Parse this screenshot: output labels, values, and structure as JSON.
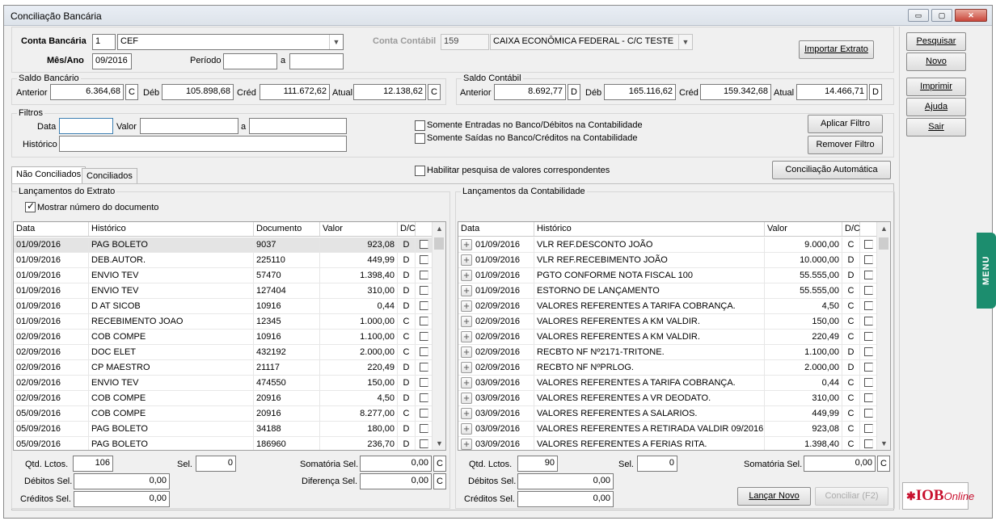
{
  "window": {
    "title": "Conciliação Bancária",
    "min": "▭",
    "restore": "▢",
    "close": "✕"
  },
  "header": {
    "conta_bancaria_label": "Conta Bancária",
    "conta_bancaria_code": "1",
    "conta_bancaria_name": "CEF",
    "mes_ano_label": "Mês/Ano",
    "mes_ano_value": "09/2016",
    "periodo_label": "Período",
    "periodo_from": "",
    "periodo_sep": "a",
    "periodo_to": "",
    "conta_contabil_label": "Conta Contábil",
    "conta_contabil_code": "159",
    "conta_contabil_name": "CAIXA ECONÔMICA FEDERAL - C/C TESTE",
    "importar": "Importar Extrato"
  },
  "saldo_bancario": {
    "title": "Saldo Bancário",
    "anterior_label": "Anterior",
    "anterior": "6.364,68",
    "anterior_dc": "C",
    "deb_label": "Déb",
    "deb": "105.898,68",
    "cred_label": "Créd",
    "cred": "111.672,62",
    "atual_label": "Atual",
    "atual": "12.138,62",
    "atual_dc": "C"
  },
  "saldo_contabil": {
    "title": "Saldo Contábil",
    "anterior_label": "Anterior",
    "anterior": "8.692,77",
    "anterior_dc": "D",
    "deb_label": "Déb",
    "deb": "165.116,62",
    "cred_label": "Créd",
    "cred": "159.342,68",
    "atual_label": "Atual",
    "atual": "14.466,71",
    "atual_dc": "D"
  },
  "filtros": {
    "title": "Filtros",
    "data_label": "Data",
    "valor_label": "Valor",
    "sep": "a",
    "historico_label": "Histórico",
    "chk1": "Somente  Entradas no Banco/Débitos na Contabilidade",
    "chk2": "Somente Saídas no Banco/Créditos na Contabilidade",
    "aplicar": "Aplicar Filtro",
    "remover": "Remover Filtro"
  },
  "tabs": {
    "nao": "Não Conciliados",
    "sim": "Conciliados"
  },
  "habilitar": "Habilitar pesquisa de valores correspondentes",
  "conciliacao_auto": "Conciliação Automática",
  "side": {
    "pesquisar": "Pesquisar",
    "novo": "Novo",
    "imprimir": "Imprimir",
    "ajuda": "Ajuda",
    "sair": "Sair",
    "menu": "MENU"
  },
  "extrato": {
    "title": "Lançamentos do Extrato",
    "mostrar": "Mostrar número do documento",
    "cols": {
      "data": "Data",
      "hist": "Histórico",
      "doc": "Documento",
      "valor": "Valor",
      "dc": "D/C"
    },
    "rows": [
      {
        "data": "01/09/2016",
        "hist": "PAG BOLETO",
        "doc": "9037",
        "valor": "923,08",
        "dc": "D"
      },
      {
        "data": "01/09/2016",
        "hist": "DEB.AUTOR.",
        "doc": "225110",
        "valor": "449,99",
        "dc": "D"
      },
      {
        "data": "01/09/2016",
        "hist": "ENVIO TEV",
        "doc": "57470",
        "valor": "1.398,40",
        "dc": "D"
      },
      {
        "data": "01/09/2016",
        "hist": "ENVIO TEV",
        "doc": "127404",
        "valor": "310,00",
        "dc": "D"
      },
      {
        "data": "01/09/2016",
        "hist": "D AT SICOB",
        "doc": "10916",
        "valor": "0,44",
        "dc": "D"
      },
      {
        "data": "01/09/2016",
        "hist": "RECEBIMENTO JOAO",
        "doc": "12345",
        "valor": "1.000,00",
        "dc": "C"
      },
      {
        "data": "02/09/2016",
        "hist": "COB COMPE",
        "doc": "10916",
        "valor": "1.100,00",
        "dc": "C"
      },
      {
        "data": "02/09/2016",
        "hist": "DOC ELET",
        "doc": "432192",
        "valor": "2.000,00",
        "dc": "C"
      },
      {
        "data": "02/09/2016",
        "hist": "CP MAESTRO",
        "doc": "21117",
        "valor": "220,49",
        "dc": "D"
      },
      {
        "data": "02/09/2016",
        "hist": "ENVIO TEV",
        "doc": "474550",
        "valor": "150,00",
        "dc": "D"
      },
      {
        "data": "02/09/2016",
        "hist": "COB COMPE",
        "doc": "20916",
        "valor": "4,50",
        "dc": "D"
      },
      {
        "data": "05/09/2016",
        "hist": "COB COMPE",
        "doc": "20916",
        "valor": "8.277,00",
        "dc": "C"
      },
      {
        "data": "05/09/2016",
        "hist": "PAG BOLETO",
        "doc": "34188",
        "valor": "180,00",
        "dc": "D"
      },
      {
        "data": "05/09/2016",
        "hist": "PAG BOLETO",
        "doc": "186960",
        "valor": "236,70",
        "dc": "D"
      }
    ],
    "qtd_label": "Qtd. Lctos.",
    "qtd": "106",
    "sel_label": "Sel.",
    "sel": "0",
    "soma_label": "Somatória Sel.",
    "soma": "0,00",
    "soma_dc": "C",
    "deb_label": "Débitos Sel.",
    "deb": "0,00",
    "dif_label": "Diferença Sel.",
    "dif": "0,00",
    "dif_dc": "C",
    "cred_label": "Créditos Sel.",
    "cred": "0,00"
  },
  "contab": {
    "title": "Lançamentos da Contabilidade",
    "cols": {
      "data": "Data",
      "hist": "Histórico",
      "valor": "Valor",
      "dc": "D/C"
    },
    "rows": [
      {
        "data": "01/09/2016",
        "hist": "VLR REF.DESCONTO JOÃO",
        "valor": "9.000,00",
        "dc": "C"
      },
      {
        "data": "01/09/2016",
        "hist": "VLR REF.RECEBIMENTO JOÃO",
        "valor": "10.000,00",
        "dc": "D"
      },
      {
        "data": "01/09/2016",
        "hist": "PGTO CONFORME NOTA FISCAL 100",
        "valor": "55.555,00",
        "dc": "D"
      },
      {
        "data": "01/09/2016",
        "hist": "ESTORNO DE LANÇAMENTO",
        "valor": "55.555,00",
        "dc": "C"
      },
      {
        "data": "02/09/2016",
        "hist": "VALORES REFERENTES A TARIFA COBRANÇA.",
        "valor": "4,50",
        "dc": "C"
      },
      {
        "data": "02/09/2016",
        "hist": "VALORES REFERENTES A KM VALDIR.",
        "valor": "150,00",
        "dc": "C"
      },
      {
        "data": "02/09/2016",
        "hist": "VALORES REFERENTES A KM VALDIR.",
        "valor": "220,49",
        "dc": "C"
      },
      {
        "data": "02/09/2016",
        "hist": "RECBTO NF Nº2171-TRITONE.",
        "valor": "1.100,00",
        "dc": "D"
      },
      {
        "data": "02/09/2016",
        "hist": "RECBTO NF NºPRLOG.",
        "valor": "2.000,00",
        "dc": "D"
      },
      {
        "data": "03/09/2016",
        "hist": "VALORES REFERENTES A TARIFA COBRANÇA.",
        "valor": "0,44",
        "dc": "C"
      },
      {
        "data": "03/09/2016",
        "hist": "VALORES REFERENTES A VR DEODATO.",
        "valor": "310,00",
        "dc": "C"
      },
      {
        "data": "03/09/2016",
        "hist": "VALORES REFERENTES A SALARIOS.",
        "valor": "449,99",
        "dc": "C"
      },
      {
        "data": "03/09/2016",
        "hist": "VALORES REFERENTES A RETIRADA VALDIR 09/2016.",
        "valor": "923,08",
        "dc": "C"
      },
      {
        "data": "03/09/2016",
        "hist": "VALORES REFERENTES A FERIAS RITA.",
        "valor": "1.398,40",
        "dc": "C"
      }
    ],
    "qtd_label": "Qtd. Lctos.",
    "qtd": "90",
    "sel_label": "Sel.",
    "sel": "0",
    "soma_label": "Somatória Sel.",
    "soma": "0,00",
    "soma_dc": "C",
    "deb_label": "Débitos Sel.",
    "deb": "0,00",
    "cred_label": "Créditos Sel.",
    "cred": "0,00",
    "lancar": "Lançar Novo",
    "conciliar": "Conciliar (F2)"
  },
  "logo": {
    "brand": "IOB",
    "sub": "Online"
  }
}
